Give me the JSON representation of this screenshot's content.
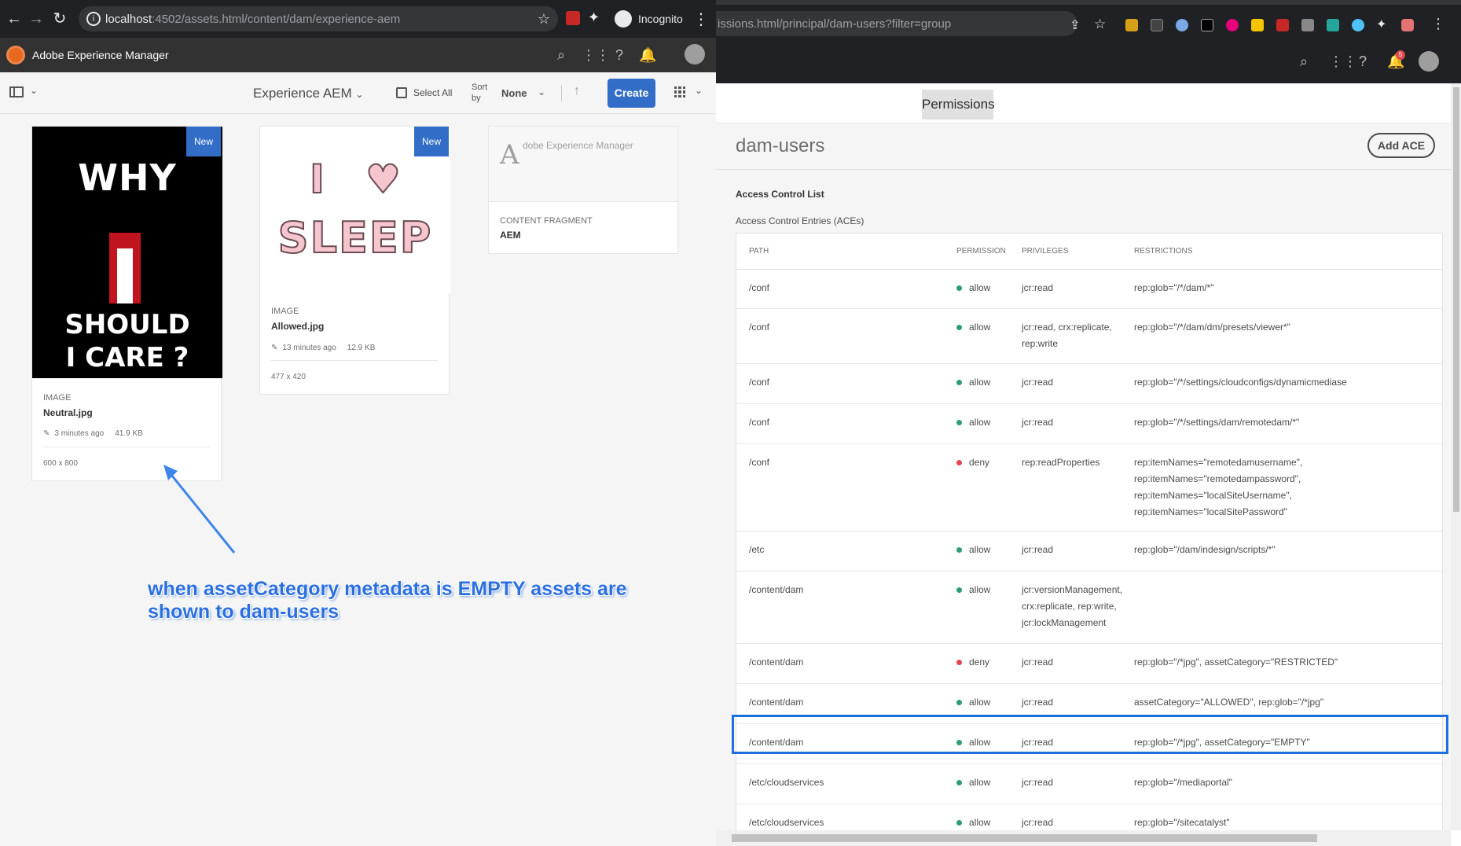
{
  "left": {
    "browser": {
      "url_host": "localhost",
      "url_rest": ":4502/assets.html/content/dam/experience-aem",
      "incognito_label": "Incognito"
    },
    "shell": {
      "app_title": "Adobe Experience Manager"
    },
    "toolbar": {
      "folder_title": "Experience AEM",
      "select_all": "Select All",
      "sort_by": "Sort by",
      "sort_value": "None",
      "create": "Create"
    },
    "cards": [
      {
        "badge": "New",
        "kind": "IMAGE",
        "name": "Neutral.jpg",
        "modified": "3 minutes ago",
        "size": "41.9 KB",
        "dims": "600 x 800",
        "thumb_lines": [
          "WHY",
          "SHOULD",
          "I CARE ?"
        ]
      },
      {
        "badge": "New",
        "kind": "IMAGE",
        "name": "Allowed.jpg",
        "modified": "13 minutes ago",
        "size": "12.9 KB",
        "dims": "477 x 420",
        "thumb_lines": [
          "I",
          "♥",
          "SLEEP"
        ]
      },
      {
        "initial": "A",
        "title": "dobe Experience Manager",
        "kind": "CONTENT FRAGMENT",
        "name": "AEM"
      }
    ],
    "annotation": "when assetCategory metadata is EMPTY assets are shown to dam-users"
  },
  "right": {
    "browser": {
      "url": "issions.html/principal/dam-users?filter=group"
    },
    "tab": "Permissions",
    "user": "dam-users",
    "add_ace": "Add ACE",
    "acl_title": "Access Control List",
    "ace_subtitle": "Access Control Entries (ACEs)",
    "bell_count": "5",
    "columns": [
      "PATH",
      "PERMISSION",
      "PRIVILEGES",
      "RESTRICTIONS"
    ],
    "rows": [
      {
        "path": "/conf",
        "permission": "allow",
        "privileges": "jcr:read",
        "restrictions": "rep:glob=\"/*/dam/*\""
      },
      {
        "path": "/conf",
        "permission": "allow",
        "privileges": "jcr:read, crx:replicate, rep:write",
        "restrictions": "rep:glob=\"/*/dam/dm/presets/viewer*\""
      },
      {
        "path": "/conf",
        "permission": "allow",
        "privileges": "jcr:read",
        "restrictions": "rep:glob=\"/*/settings/cloudconfigs/dynamicmediase"
      },
      {
        "path": "/conf",
        "permission": "allow",
        "privileges": "jcr:read",
        "restrictions": "rep:glob=\"/*/settings/dam/remotedam/*\""
      },
      {
        "path": "/conf",
        "permission": "deny",
        "privileges": "rep:readProperties",
        "restrictions": "rep:itemNames=\"remotedamusername\",\nrep:itemNames=\"remotedampassword\",\nrep:itemNames=\"localSiteUsername\",\nrep:itemNames=\"localSitePassword\""
      },
      {
        "path": "/etc",
        "permission": "allow",
        "privileges": "jcr:read",
        "restrictions": "rep:glob=\"/dam/indesign/scripts/*\""
      },
      {
        "path": "/content/dam",
        "permission": "allow",
        "privileges": "jcr:versionManagement, crx:replicate, rep:write, jcr:lockManagement",
        "restrictions": ""
      },
      {
        "path": "/content/dam",
        "permission": "deny",
        "privileges": "jcr:read",
        "restrictions": "rep:glob=\"/*jpg\", assetCategory=\"RESTRICTED\""
      },
      {
        "path": "/content/dam",
        "permission": "allow",
        "privileges": "jcr:read",
        "restrictions": "assetCategory=\"ALLOWED\", rep:glob=\"/*jpg\""
      },
      {
        "path": "/content/dam",
        "permission": "allow",
        "privileges": "jcr:read",
        "restrictions": "rep:glob=\"/*jpg\", assetCategory=\"EMPTY\""
      },
      {
        "path": "/etc/cloudservices",
        "permission": "allow",
        "privileges": "jcr:read",
        "restrictions": "rep:glob=\"/mediaportal\""
      },
      {
        "path": "/etc/cloudservices",
        "permission": "allow",
        "privileges": "jcr:read",
        "restrictions": "rep:glob=\"/sitecatalyst\""
      }
    ],
    "colors": {
      "allow": "#2d9d78",
      "deny": "#e34850",
      "highlight": "#1e6fe0"
    }
  }
}
